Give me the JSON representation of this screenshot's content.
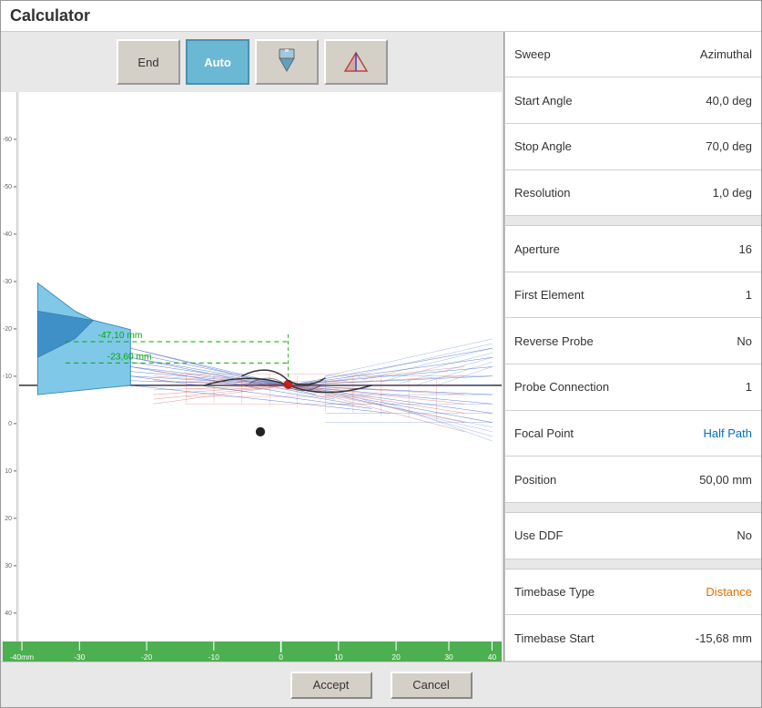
{
  "title": "Calculator",
  "toolbar": {
    "end_label": "End",
    "auto_label": "Auto"
  },
  "properties": [
    {
      "label": "Sweep",
      "value": "Azimuthal",
      "color": "normal",
      "separator_after": false
    },
    {
      "label": "Start Angle",
      "value": "40,0 deg",
      "color": "normal",
      "separator_after": false
    },
    {
      "label": "Stop Angle",
      "value": "70,0 deg",
      "color": "normal",
      "separator_after": false
    },
    {
      "label": "Resolution",
      "value": "1,0 deg",
      "color": "normal",
      "separator_after": true
    },
    {
      "label": "Aperture",
      "value": "16",
      "color": "normal",
      "separator_after": false
    },
    {
      "label": "First Element",
      "value": "1",
      "color": "normal",
      "separator_after": false
    },
    {
      "label": "Reverse Probe",
      "value": "No",
      "color": "normal",
      "separator_after": false
    },
    {
      "label": "Probe Connection",
      "value": "1",
      "color": "normal",
      "separator_after": false
    },
    {
      "label": "Focal Point",
      "value": "Half Path",
      "color": "blue",
      "separator_after": false
    },
    {
      "label": "Position",
      "value": "50,00 mm",
      "color": "normal",
      "separator_after": true
    },
    {
      "label": "Use DDF",
      "value": "No",
      "color": "normal",
      "separator_after": true
    },
    {
      "label": "Timebase Type",
      "value": "Distance",
      "color": "orange",
      "separator_after": false
    },
    {
      "label": "Timebase Start",
      "value": "-15,68 mm",
      "color": "normal",
      "separator_after": false
    }
  ],
  "buttons": {
    "accept": "Accept",
    "cancel": "Cancel"
  },
  "ruler": {
    "labels": [
      "-40mm",
      "-30",
      "-20",
      "-10",
      "0",
      "10",
      "20",
      "30",
      "40"
    ]
  },
  "annotations": {
    "dim1": "-47,10 mm",
    "dim2": "-23,60 mm"
  }
}
